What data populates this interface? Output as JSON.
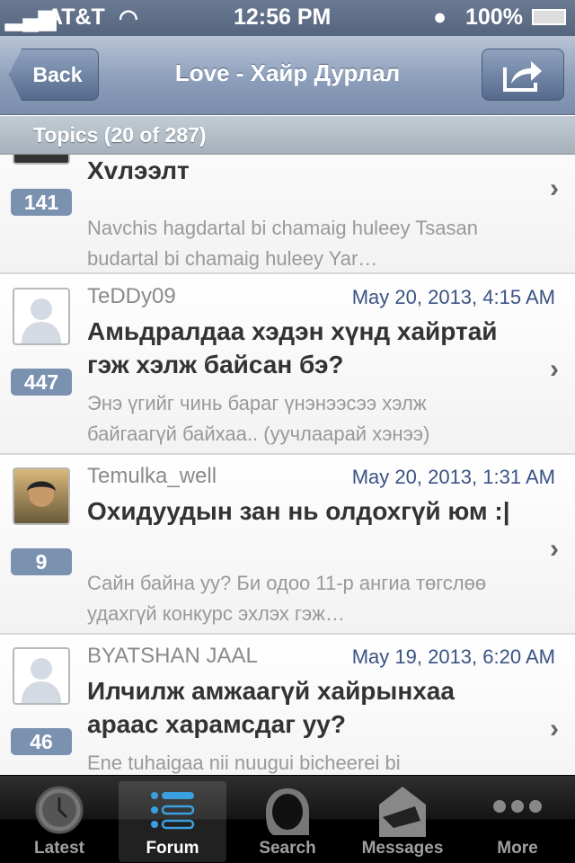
{
  "status": {
    "carrier": "AT&T",
    "time": "12:56 PM",
    "battery": "100%"
  },
  "nav": {
    "back": "Back",
    "title": "Love - Хайр Дурлал"
  },
  "section": "Topics (20 of 287)",
  "topics": [
    {
      "user": "",
      "date": "",
      "title": "Хvлээлт",
      "preview": "Navchis hagdartal bi chamaig huleey Tsasan budartal bi chamaig huleey Yar…",
      "count": "141"
    },
    {
      "user": "TeDDy09",
      "date": "May 20, 2013, 4:15 AM",
      "title": "Амьдралдаа хэдэн хүнд хайртай гэж хэлж байсан бэ?",
      "preview": "Энэ үгийг чинь бараг үнэнээсээ хэлж байгаагүй байхаа.. (уучлаарай хэнээ)",
      "count": "447"
    },
    {
      "user": "Temulka_well",
      "date": "May 20, 2013, 1:31 AM",
      "title": "Охидуудын зан нь олдохгүй юм :|",
      "preview": "Сайн байна уу? Би одоо 11-р ангиа төгслөө удахгүй конкурс эхлэх гэж…",
      "count": "9"
    },
    {
      "user": "BYATSHAN JAAL",
      "date": "May 19, 2013, 6:20 AM",
      "title": "Илчилж амжаагүй хайрынхаа араас харамсдаг уу?",
      "preview": "Ene tuhaigaa nii nuugui bicheerei bi",
      "count": "46"
    }
  ],
  "tabs": [
    {
      "label": "Latest"
    },
    {
      "label": "Forum"
    },
    {
      "label": "Search"
    },
    {
      "label": "Messages"
    },
    {
      "label": "More"
    }
  ]
}
